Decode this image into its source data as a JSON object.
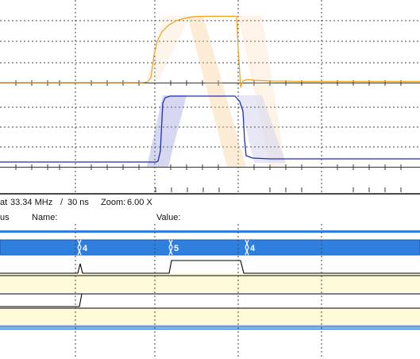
{
  "timebase": {
    "prefix": "at",
    "frequency": "33.34 MHz",
    "period": "30 ns",
    "zoom_label": "Zoom:",
    "zoom_value": "6.00 X"
  },
  "columns": {
    "bus": "us",
    "name": "Name:",
    "value": "Value:"
  },
  "bus_values": [
    "4",
    "5",
    "4"
  ],
  "colors": {
    "bus_fill": "#2f7fde",
    "bus_border": "#1a5cb0",
    "yellow_row": "#fffbd9",
    "channel_orange": "#f0a020",
    "channel_blue": "#1f2fb5",
    "grid": "#3a3a3a"
  }
}
